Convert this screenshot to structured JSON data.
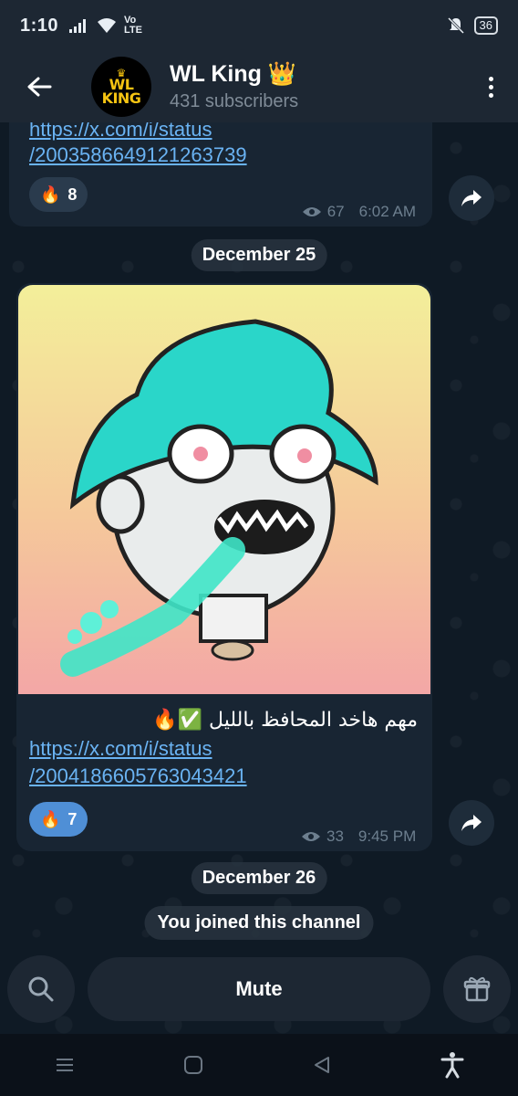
{
  "status_bar": {
    "time": "1:10",
    "network_label": "Vo LTE",
    "battery": "36"
  },
  "header": {
    "title": "WL King 👑",
    "subscribers": "431 subscribers",
    "avatar_logo_text": "WL KING"
  },
  "messages": [
    {
      "link_line1": "https://x.com/i/status",
      "link_line2": "/2003586649121263739",
      "reaction_emoji": "🔥",
      "reaction_count": "8",
      "views": "67",
      "time": "6:02 AM"
    },
    {
      "caption": "مهم هاخد المحافظ بالليل ✅🔥",
      "link_line1": "https://x.com/i/status",
      "link_line2": "/2004186605763043421",
      "reaction_emoji": "🔥",
      "reaction_count": "7",
      "views": "33",
      "time": "9:45 PM"
    }
  ],
  "dates": {
    "first": "December 25",
    "second": "December 26"
  },
  "service_message": "You joined this channel",
  "bottom": {
    "mute_label": "Mute"
  },
  "colors": {
    "link": "#6ab3f3",
    "bubble": "#182533",
    "header": "#1d2733",
    "reaction_active": "#4f8fd6"
  }
}
